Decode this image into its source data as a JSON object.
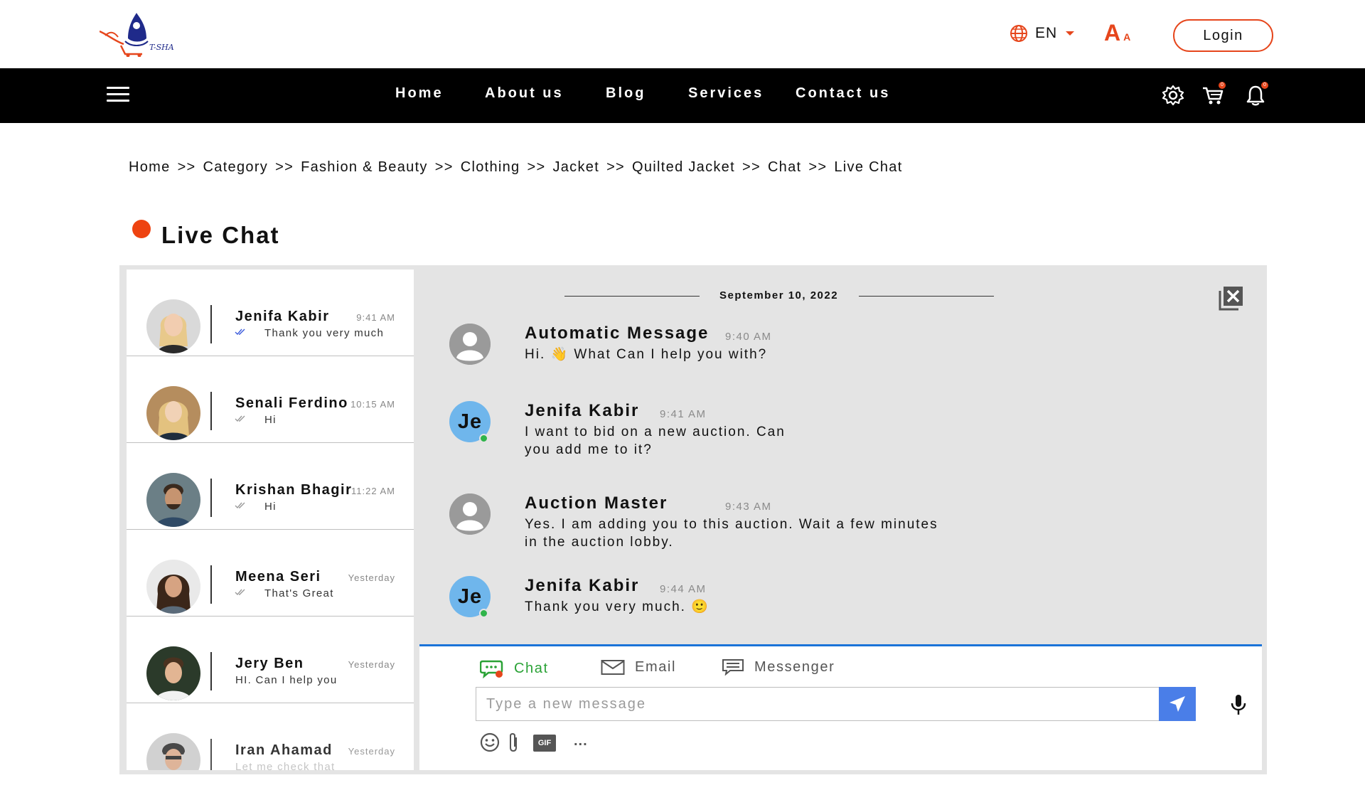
{
  "header": {
    "logo_text": "T-SHA",
    "language": "EN",
    "font_size_large": "A",
    "font_size_small": "A",
    "login_label": "Login"
  },
  "nav": {
    "links": [
      "Home",
      "About us",
      "Blog",
      "Services",
      "Contact us"
    ],
    "cart_badge": "0",
    "notification_badge": "0"
  },
  "breadcrumb": [
    "Home",
    "Category",
    "Fashion & Beauty",
    "Clothing",
    "Jacket",
    "Quilted Jacket",
    "Chat",
    "Live Chat"
  ],
  "breadcrumb_separator": ">>",
  "page_title": "Live Chat",
  "contacts": [
    {
      "name": "Jenifa Kabir",
      "time": "9:41 AM",
      "preview": "Thank you very much"
    },
    {
      "name": "Senali Ferdino",
      "time": "10:15 AM",
      "preview": "Hi"
    },
    {
      "name": "Krishan Bhagir",
      "time": "11:22 AM",
      "preview": "Hi"
    },
    {
      "name": "Meena Seri",
      "time": "Yesterday",
      "preview": "That's Great"
    },
    {
      "name": "Jery Ben",
      "time": "Yesterday",
      "preview": "HI. Can I help you"
    },
    {
      "name": "Iran Ahamad",
      "time": "Yesterday",
      "preview": "Let me check that"
    }
  ],
  "conversation": {
    "date": "September 10, 2022",
    "messages": [
      {
        "sender": "Automatic Message",
        "time": "9:40 AM",
        "text": "Hi. 👋 What Can I help you with?"
      },
      {
        "sender": "Jenifa Kabir",
        "initials": "Je",
        "time": "9:41 AM",
        "line1": "I want to bid on a new auction. Can",
        "line2": "you add me to it?"
      },
      {
        "sender": "Auction Master",
        "time": "9:43 AM",
        "line1": "Yes. I am adding you to this auction. Wait a few minutes",
        "line2": "in the auction lobby."
      },
      {
        "sender": "Jenifa Kabir",
        "initials": "Je",
        "time": "9:44 AM",
        "text": "Thank you very much. 🙂"
      }
    ]
  },
  "composer": {
    "tabs": [
      "Chat",
      "Email",
      "Messenger"
    ],
    "placeholder": "Type a new message",
    "gif_label": "GIF",
    "more_label": "..."
  },
  "colors": {
    "accent_orange": "#e6461c",
    "active_green": "#2aa236",
    "send_blue": "#4a7ee8",
    "composer_border": "#1a73d8",
    "panel_gray": "#e4e4e4"
  }
}
